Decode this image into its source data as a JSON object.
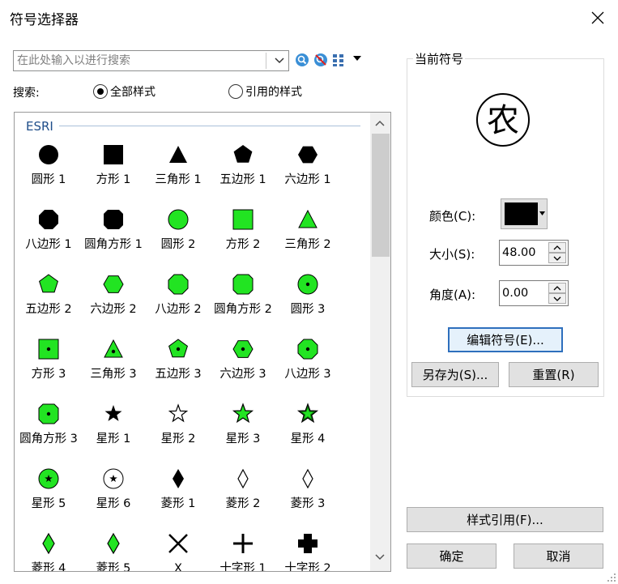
{
  "window": {
    "title": "符号选择器"
  },
  "search": {
    "placeholder": "在此处输入以进行搜索",
    "label": "搜索:"
  },
  "scope_options": [
    {
      "label": "全部样式",
      "selected": true
    },
    {
      "label": "引用的样式",
      "selected": false
    }
  ],
  "toolbar_icons": [
    "search-icon",
    "clear-search-icon",
    "view-options-icon"
  ],
  "gallery": {
    "group": "ESRI",
    "items": [
      {
        "label": "圆形 1",
        "icon": "circle-icon"
      },
      {
        "label": "方形 1",
        "icon": "square-icon"
      },
      {
        "label": "三角形 1",
        "icon": "triangle-icon"
      },
      {
        "label": "五边形 1",
        "icon": "pentagon-icon"
      },
      {
        "label": "六边形 1",
        "icon": "hexagon-icon"
      },
      {
        "label": "八边形 1",
        "icon": "octagon-icon"
      },
      {
        "label": "圆角方形 1",
        "icon": "rounded-square-icon"
      },
      {
        "label": "圆形 2",
        "icon": "circle-icon"
      },
      {
        "label": "方形 2",
        "icon": "square-icon"
      },
      {
        "label": "三角形 2",
        "icon": "triangle-icon"
      },
      {
        "label": "五边形 2",
        "icon": "pentagon-icon"
      },
      {
        "label": "六边形 2",
        "icon": "hexagon-icon"
      },
      {
        "label": "八边形 2",
        "icon": "octagon-icon"
      },
      {
        "label": "圆角方形 2",
        "icon": "rounded-square-icon"
      },
      {
        "label": "圆形 3",
        "icon": "circle-dot-icon"
      },
      {
        "label": "方形 3",
        "icon": "square-dot-icon"
      },
      {
        "label": "三角形 3",
        "icon": "triangle-dot-icon"
      },
      {
        "label": "五边形 3",
        "icon": "pentagon-dot-icon"
      },
      {
        "label": "六边形 3",
        "icon": "hexagon-dot-icon"
      },
      {
        "label": "八边形 3",
        "icon": "octagon-dot-icon"
      },
      {
        "label": "圆角方形 3",
        "icon": "rounded-square-dot-icon"
      },
      {
        "label": "星形 1",
        "icon": "star-icon"
      },
      {
        "label": "星形 2",
        "icon": "star-outline-icon"
      },
      {
        "label": "星形 3",
        "icon": "star-green-icon"
      },
      {
        "label": "星形 4",
        "icon": "star-green-dark-icon"
      },
      {
        "label": "星形 5",
        "icon": "circle-star-icon"
      },
      {
        "label": "星形 6",
        "icon": "circle-star-white-icon"
      },
      {
        "label": "菱形 1",
        "icon": "diamond-icon"
      },
      {
        "label": "菱形 2",
        "icon": "diamond-outline-icon"
      },
      {
        "label": "菱形 3",
        "icon": "diamond-outline-icon"
      },
      {
        "label": "菱形 4",
        "icon": "diamond-green-icon"
      },
      {
        "label": "菱形 5",
        "icon": "diamond-green-icon"
      },
      {
        "label": "X",
        "icon": "x-icon"
      },
      {
        "label": "十字形 1",
        "icon": "cross-icon"
      },
      {
        "label": "十字形 2",
        "icon": "bold-cross-icon"
      }
    ]
  },
  "current_symbol": {
    "legend": "当前符号",
    "preview_char": "农",
    "color_label": "颜色(C):",
    "color_value": "#000000",
    "size_label": "大小(S):",
    "size_value": "48.00",
    "angle_label": "角度(A):",
    "angle_value": "0.00",
    "edit_button": "编辑符号(E)...",
    "save_as_button": "另存为(S)...",
    "reset_button": "重置(R)"
  },
  "style_ref_button": "样式引用(F)...",
  "ok_button": "确定",
  "cancel_button": "取消",
  "colors": {
    "fill_green": "#22e422",
    "accent_blue": "#2e6fbd",
    "group_header": "#1f4e8a"
  }
}
